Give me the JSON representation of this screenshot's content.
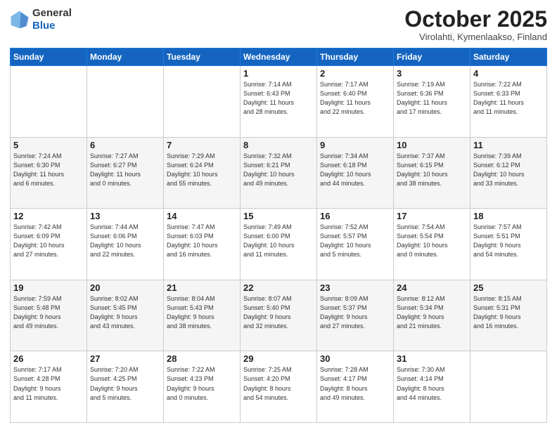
{
  "header": {
    "logo_line1": "General",
    "logo_line2": "Blue",
    "month": "October 2025",
    "location": "Virolahti, Kymenlaakso, Finland"
  },
  "weekdays": [
    "Sunday",
    "Monday",
    "Tuesday",
    "Wednesday",
    "Thursday",
    "Friday",
    "Saturday"
  ],
  "weeks": [
    [
      {
        "day": "",
        "info": ""
      },
      {
        "day": "",
        "info": ""
      },
      {
        "day": "",
        "info": ""
      },
      {
        "day": "1",
        "info": "Sunrise: 7:14 AM\nSunset: 6:43 PM\nDaylight: 11 hours\nand 28 minutes."
      },
      {
        "day": "2",
        "info": "Sunrise: 7:17 AM\nSunset: 6:40 PM\nDaylight: 11 hours\nand 22 minutes."
      },
      {
        "day": "3",
        "info": "Sunrise: 7:19 AM\nSunset: 6:36 PM\nDaylight: 11 hours\nand 17 minutes."
      },
      {
        "day": "4",
        "info": "Sunrise: 7:22 AM\nSunset: 6:33 PM\nDaylight: 11 hours\nand 11 minutes."
      }
    ],
    [
      {
        "day": "5",
        "info": "Sunrise: 7:24 AM\nSunset: 6:30 PM\nDaylight: 11 hours\nand 6 minutes."
      },
      {
        "day": "6",
        "info": "Sunrise: 7:27 AM\nSunset: 6:27 PM\nDaylight: 11 hours\nand 0 minutes."
      },
      {
        "day": "7",
        "info": "Sunrise: 7:29 AM\nSunset: 6:24 PM\nDaylight: 10 hours\nand 55 minutes."
      },
      {
        "day": "8",
        "info": "Sunrise: 7:32 AM\nSunset: 6:21 PM\nDaylight: 10 hours\nand 49 minutes."
      },
      {
        "day": "9",
        "info": "Sunrise: 7:34 AM\nSunset: 6:18 PM\nDaylight: 10 hours\nand 44 minutes."
      },
      {
        "day": "10",
        "info": "Sunrise: 7:37 AM\nSunset: 6:15 PM\nDaylight: 10 hours\nand 38 minutes."
      },
      {
        "day": "11",
        "info": "Sunrise: 7:39 AM\nSunset: 6:12 PM\nDaylight: 10 hours\nand 33 minutes."
      }
    ],
    [
      {
        "day": "12",
        "info": "Sunrise: 7:42 AM\nSunset: 6:09 PM\nDaylight: 10 hours\nand 27 minutes."
      },
      {
        "day": "13",
        "info": "Sunrise: 7:44 AM\nSunset: 6:06 PM\nDaylight: 10 hours\nand 22 minutes."
      },
      {
        "day": "14",
        "info": "Sunrise: 7:47 AM\nSunset: 6:03 PM\nDaylight: 10 hours\nand 16 minutes."
      },
      {
        "day": "15",
        "info": "Sunrise: 7:49 AM\nSunset: 6:00 PM\nDaylight: 10 hours\nand 11 minutes."
      },
      {
        "day": "16",
        "info": "Sunrise: 7:52 AM\nSunset: 5:57 PM\nDaylight: 10 hours\nand 5 minutes."
      },
      {
        "day": "17",
        "info": "Sunrise: 7:54 AM\nSunset: 5:54 PM\nDaylight: 10 hours\nand 0 minutes."
      },
      {
        "day": "18",
        "info": "Sunrise: 7:57 AM\nSunset: 5:51 PM\nDaylight: 9 hours\nand 54 minutes."
      }
    ],
    [
      {
        "day": "19",
        "info": "Sunrise: 7:59 AM\nSunset: 5:48 PM\nDaylight: 9 hours\nand 49 minutes."
      },
      {
        "day": "20",
        "info": "Sunrise: 8:02 AM\nSunset: 5:45 PM\nDaylight: 9 hours\nand 43 minutes."
      },
      {
        "day": "21",
        "info": "Sunrise: 8:04 AM\nSunset: 5:43 PM\nDaylight: 9 hours\nand 38 minutes."
      },
      {
        "day": "22",
        "info": "Sunrise: 8:07 AM\nSunset: 5:40 PM\nDaylight: 9 hours\nand 32 minutes."
      },
      {
        "day": "23",
        "info": "Sunrise: 8:09 AM\nSunset: 5:37 PM\nDaylight: 9 hours\nand 27 minutes."
      },
      {
        "day": "24",
        "info": "Sunrise: 8:12 AM\nSunset: 5:34 PM\nDaylight: 9 hours\nand 21 minutes."
      },
      {
        "day": "25",
        "info": "Sunrise: 8:15 AM\nSunset: 5:31 PM\nDaylight: 9 hours\nand 16 minutes."
      }
    ],
    [
      {
        "day": "26",
        "info": "Sunrise: 7:17 AM\nSunset: 4:28 PM\nDaylight: 9 hours\nand 11 minutes."
      },
      {
        "day": "27",
        "info": "Sunrise: 7:20 AM\nSunset: 4:25 PM\nDaylight: 9 hours\nand 5 minutes."
      },
      {
        "day": "28",
        "info": "Sunrise: 7:22 AM\nSunset: 4:23 PM\nDaylight: 9 hours\nand 0 minutes."
      },
      {
        "day": "29",
        "info": "Sunrise: 7:25 AM\nSunset: 4:20 PM\nDaylight: 8 hours\nand 54 minutes."
      },
      {
        "day": "30",
        "info": "Sunrise: 7:28 AM\nSunset: 4:17 PM\nDaylight: 8 hours\nand 49 minutes."
      },
      {
        "day": "31",
        "info": "Sunrise: 7:30 AM\nSunset: 4:14 PM\nDaylight: 8 hours\nand 44 minutes."
      },
      {
        "day": "",
        "info": ""
      }
    ]
  ]
}
